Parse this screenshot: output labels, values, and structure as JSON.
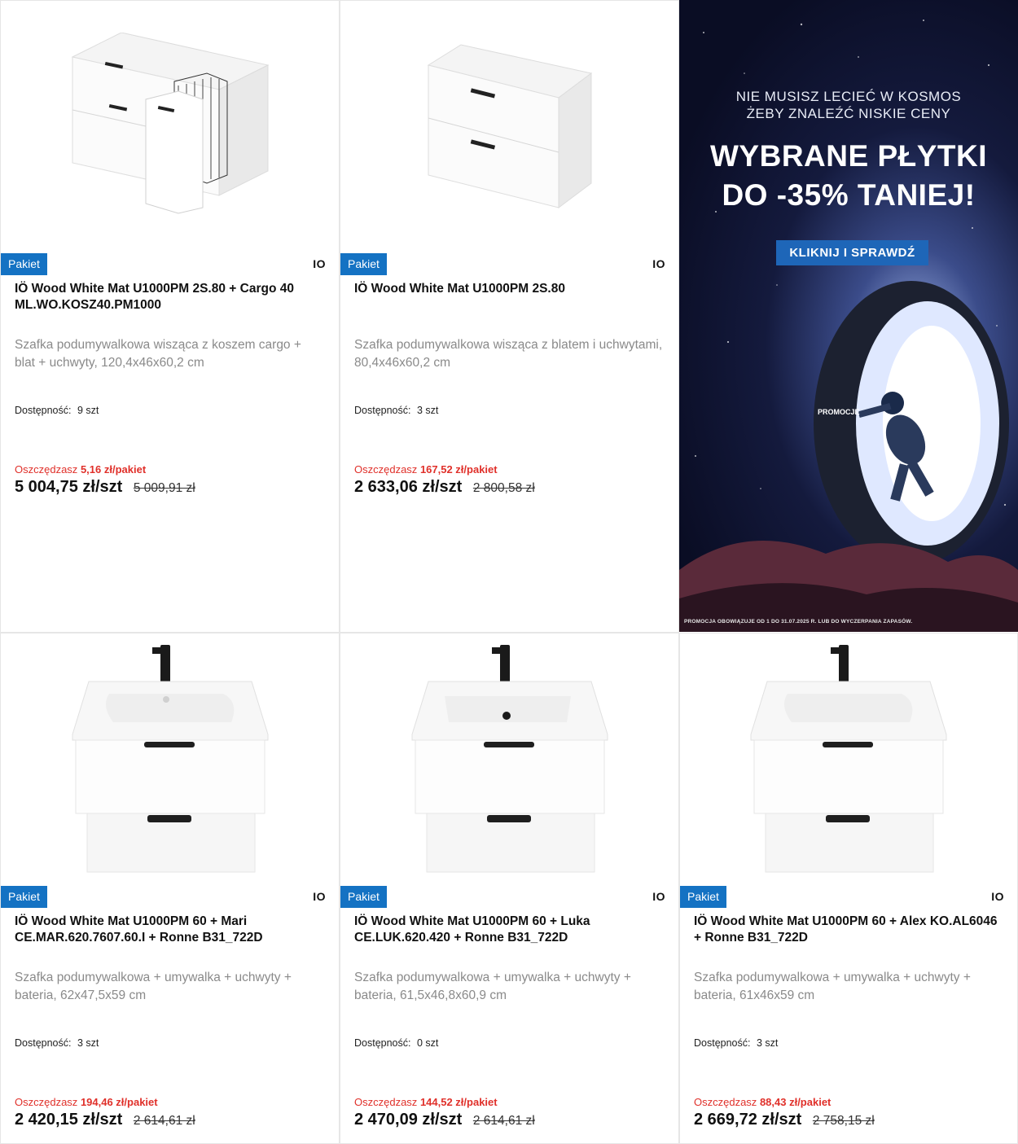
{
  "colors": {
    "badge": "#1472c3",
    "savings": "#e0302a",
    "cta": "#1e66b8"
  },
  "products": [
    {
      "badge": "Pakiet",
      "brand": "IO",
      "title": "IÖ Wood White Mat U1000PM 2S.80 + Cargo 40 ML.WO.KOSZ40.PM1000",
      "description": "Szafka podumywalkowa wisząca z koszem cargo + blat + uchwyty, 120,4x46x60,2 cm",
      "availability_label": "Dostępność:",
      "availability_value": "9 szt",
      "savings_label": "Oszczędzasz",
      "savings_value": "5,16 zł/pakiet",
      "price": "5 004,75 zł/szt",
      "old_price": "5 009,91 zł",
      "image_icon": "cabinet-cargo-image"
    },
    {
      "badge": "Pakiet",
      "brand": "IO",
      "title": "IÖ Wood White Mat U1000PM 2S.80",
      "description": "Szafka podumywalkowa wisząca z blatem i uchwytami, 80,4x46x60,2 cm",
      "availability_label": "Dostępność:",
      "availability_value": "3 szt",
      "savings_label": "Oszczędzasz",
      "savings_value": "167,52 zł/pakiet",
      "price": "2 633,06 zł/szt",
      "old_price": "2 800,58 zł",
      "image_icon": "cabinet-image"
    },
    {
      "badge": "Pakiet",
      "brand": "IO",
      "title": "IÖ Wood White Mat U1000PM 60 + Mari CE.MAR.620.7607.60.I + Ronne B31_722D",
      "description": "Szafka podumywalkowa + umywalka + uchwyty + bateria, 62x47,5x59 cm",
      "availability_label": "Dostępność:",
      "availability_value": "3 szt",
      "savings_label": "Oszczędzasz",
      "savings_value": "194,46 zł/pakiet",
      "price": "2 420,15 zł/szt",
      "old_price": "2 614,61 zł",
      "image_icon": "vanity-sink-image"
    },
    {
      "badge": "Pakiet",
      "brand": "IO",
      "title": "IÖ Wood White Mat U1000PM 60 + Luka CE.LUK.620.420 + Ronne B31_722D",
      "description": "Szafka podumywalkowa + umywalka + uchwyty + bateria, 61,5x46,8x60,9 cm",
      "availability_label": "Dostępność:",
      "availability_value": "0 szt",
      "savings_label": "Oszczędzasz",
      "savings_value": "144,52 zł/pakiet",
      "price": "2 470,09 zł/szt",
      "old_price": "2 614,61 zł",
      "image_icon": "vanity-sink-image"
    },
    {
      "badge": "Pakiet",
      "brand": "IO",
      "title": "IÖ Wood White Mat U1000PM 60 + Alex KO.AL6046 + Ronne B31_722D",
      "description": "Szafka podumywalkowa + umywalka + uchwyty + bateria, 61x46x59 cm",
      "availability_label": "Dostępność:",
      "availability_value": "3 szt",
      "savings_label": "Oszczędzasz",
      "savings_value": "88,43 zł/pakiet",
      "price": "2 669,72 zł/szt",
      "old_price": "2 758,15 zł",
      "image_icon": "vanity-sink-image"
    }
  ],
  "promo": {
    "line1": "NIE MUSISZ LECIEĆ W KOSMOS",
    "line2": "ŻEBY ZNALEŹĆ NISKIE CENY",
    "headline1": "WYBRANE PŁYTKI",
    "headline2": "DO -35% TANIEJ!",
    "cta": "KLIKNIJ I SPRAWDŹ",
    "tag": "PROMOCJE",
    "fine_print": "PROMOCJA OBOWIĄZUJE OD 1 DO 31.07.2025 R. LUB DO WYCZERPANIA ZAPASÓW."
  }
}
